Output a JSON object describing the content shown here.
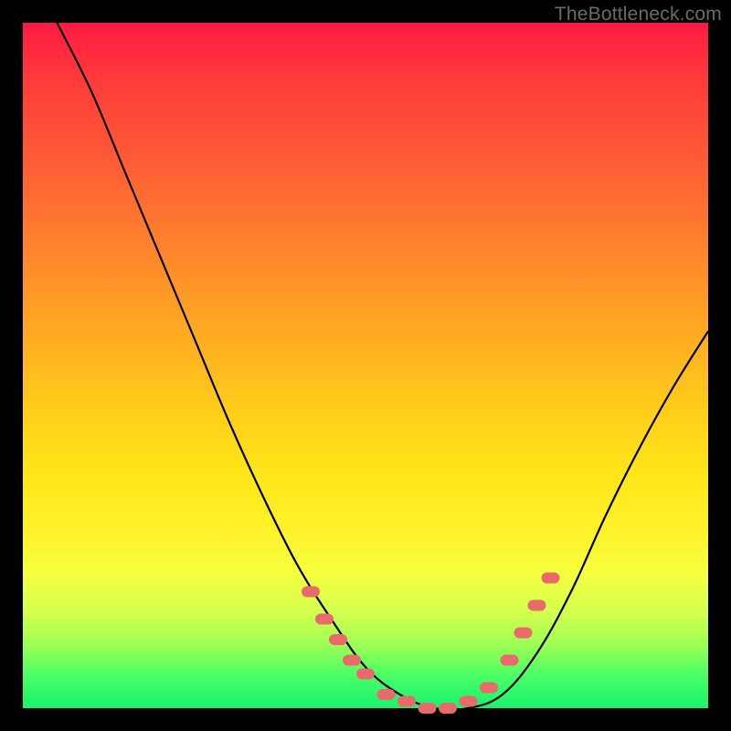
{
  "watermark": "TheBottleneck.com",
  "colors": {
    "background": "#000000",
    "curve": "#000000",
    "marker": "#e96a6a",
    "gradient_top": "#ff1a44",
    "gradient_bottom": "#18f36d"
  },
  "chart_data": {
    "type": "line",
    "title": "",
    "xlabel": "",
    "ylabel": "",
    "xlim": [
      0,
      100
    ],
    "ylim": [
      0,
      100
    ],
    "grid": false,
    "legend": false,
    "series": [
      {
        "name": "bottleneck-curve",
        "x": [
          5,
          10,
          15,
          20,
          25,
          30,
          35,
          40,
          45,
          50,
          55,
          60,
          65,
          70,
          75,
          80,
          85,
          90,
          95,
          100
        ],
        "y": [
          100,
          90,
          78,
          66,
          54,
          42,
          31,
          21,
          13,
          6,
          2,
          0,
          0,
          2,
          8,
          17,
          28,
          38,
          47,
          55
        ]
      }
    ],
    "markers": [
      {
        "x": 42,
        "y": 17
      },
      {
        "x": 44,
        "y": 13
      },
      {
        "x": 46,
        "y": 10
      },
      {
        "x": 48,
        "y": 7
      },
      {
        "x": 50,
        "y": 5
      },
      {
        "x": 53,
        "y": 2
      },
      {
        "x": 56,
        "y": 1
      },
      {
        "x": 59,
        "y": 0
      },
      {
        "x": 62,
        "y": 0
      },
      {
        "x": 65,
        "y": 1
      },
      {
        "x": 68,
        "y": 3
      },
      {
        "x": 71,
        "y": 7
      },
      {
        "x": 73,
        "y": 11
      },
      {
        "x": 75,
        "y": 15
      },
      {
        "x": 77,
        "y": 19
      }
    ]
  }
}
